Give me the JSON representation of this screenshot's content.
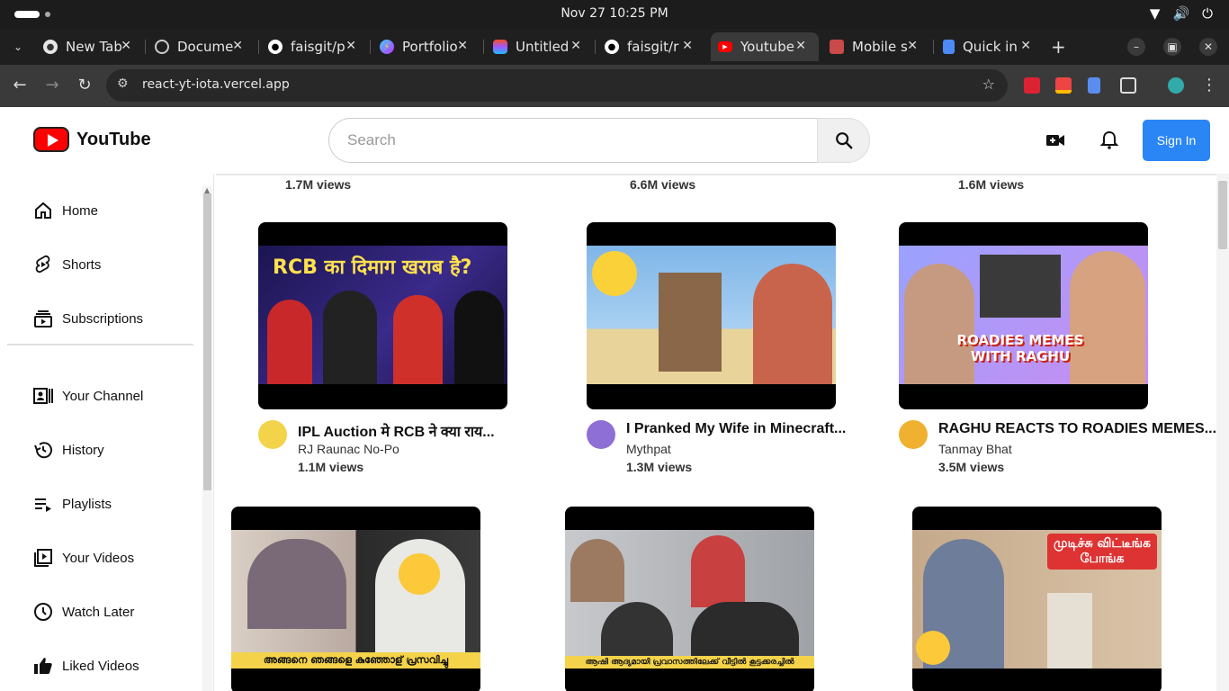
{
  "os": {
    "clock": "Nov 27  10:25 PM"
  },
  "tabs": [
    {
      "label": "New Tab",
      "icon": "chrome-icon",
      "active": false
    },
    {
      "label": "Document",
      "icon": "globe-icon",
      "active": false
    },
    {
      "label": "faisgit/p",
      "icon": "github-icon",
      "active": false
    },
    {
      "label": "Portfolio",
      "icon": "vite-icon",
      "active": false
    },
    {
      "label": "Untitled",
      "icon": "figma-icon",
      "active": false
    },
    {
      "label": "faisgit/r",
      "icon": "github-icon",
      "active": false
    },
    {
      "label": "Youtube",
      "icon": "youtube-icon",
      "active": true
    },
    {
      "label": "Mobile s",
      "icon": "site-icon",
      "active": false
    },
    {
      "label": "Quick in",
      "icon": "docs-icon",
      "active": false
    }
  ],
  "browser": {
    "url": "react-yt-iota.vercel.app"
  },
  "header": {
    "brand": "YouTube",
    "search_placeholder": "Search",
    "signin": "Sign In"
  },
  "sidebar": {
    "items": [
      {
        "label": "Home",
        "icon": "home-icon"
      },
      {
        "label": "Shorts",
        "icon": "shorts-icon"
      },
      {
        "label": "Subscriptions",
        "icon": "subscriptions-icon"
      },
      {
        "label": "Your Channel",
        "icon": "channel-icon"
      },
      {
        "label": "History",
        "icon": "history-icon"
      },
      {
        "label": "Playlists",
        "icon": "playlist-icon"
      },
      {
        "label": "Your Videos",
        "icon": "your-videos-icon"
      },
      {
        "label": "Watch Later",
        "icon": "clock-icon"
      },
      {
        "label": "Liked Videos",
        "icon": "thumbs-up-icon"
      }
    ]
  },
  "feed": {
    "top_views": [
      "1.7M views",
      "6.6M views",
      "1.6M views"
    ],
    "videos": [
      {
        "title": "IPL Auction मे RCB ने क्या राय...",
        "channel": "RJ Raunac No-Po",
        "views": "1.1M views",
        "thumb_text": "RCB का दिमाग खराब है?"
      },
      {
        "title": "I Pranked My Wife in Minecraft...",
        "channel": "Mythpat",
        "views": "1.3M views",
        "thumb_text": ""
      },
      {
        "title": "RAGHU REACTS TO ROADIES MEMES...",
        "channel": "Tanmay Bhat",
        "views": "3.5M views",
        "thumb_text": "ROADIES MEMES WITH RAGHU"
      },
      {
        "title": "",
        "channel": "",
        "views": "",
        "thumb_text": "അങ്ങനെ ഞങ്ങളെ കുഞ്ഞോള് പ്രസവിച്ചു"
      },
      {
        "title": "",
        "channel": "",
        "views": "",
        "thumb_text": "ആഷി ആദ്യമായി പ്രവാസത്തിലേക്ക് വീട്ടിൽ കൂട്ടക്കരച്ചിൽ"
      },
      {
        "title": "",
        "channel": "",
        "views": "",
        "thumb_text": "முடிச்சு விட்டீங்க போங்க"
      }
    ]
  },
  "colors": {
    "accent": "#2a85f5",
    "brand_red": "#ff0000"
  }
}
